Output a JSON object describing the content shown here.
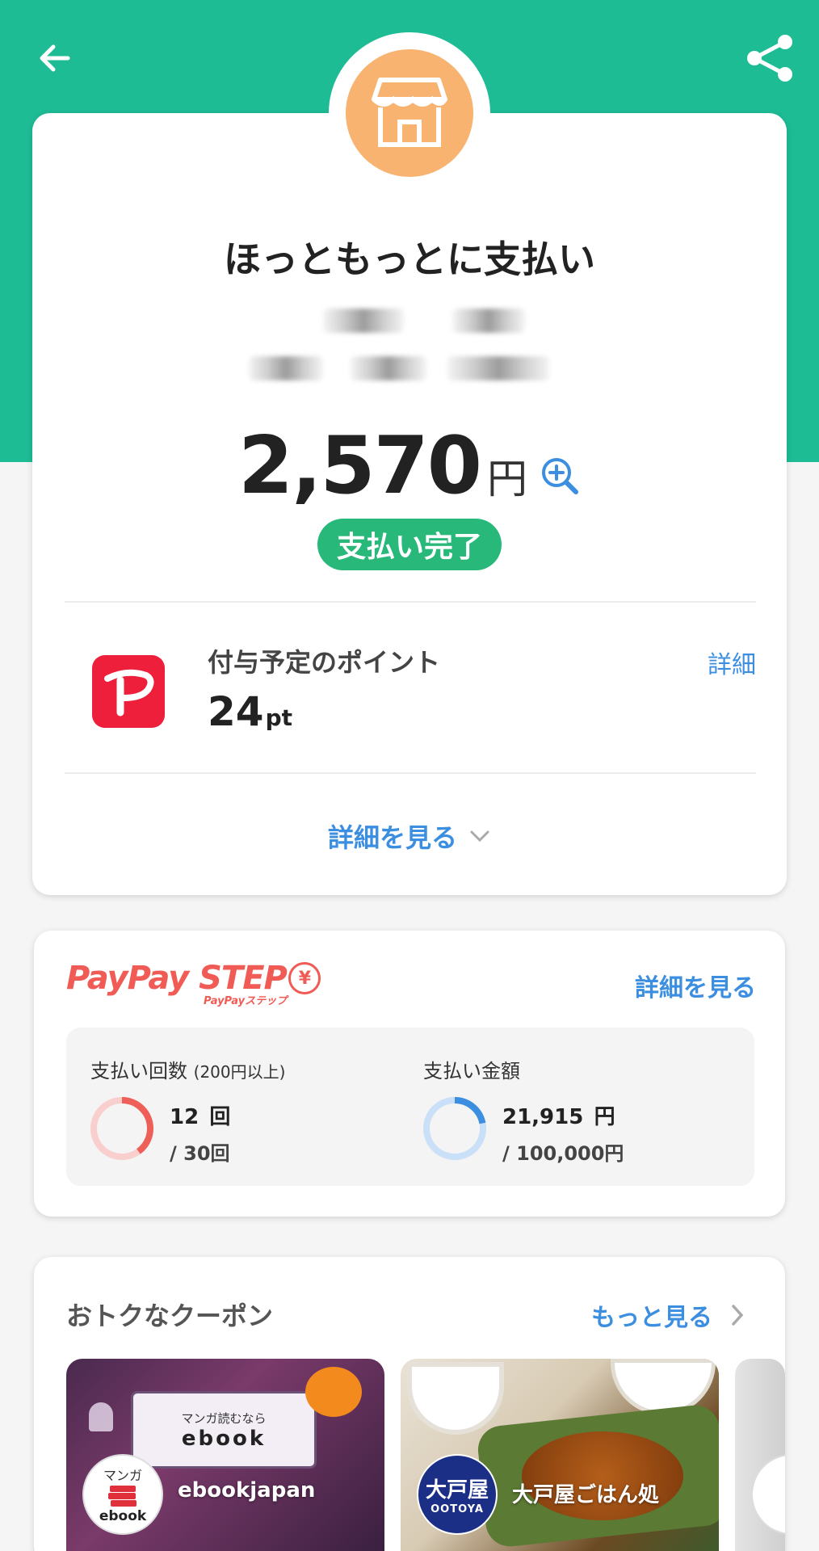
{
  "header": {
    "back_icon": "arrow-left-icon",
    "share_icon": "share-icon",
    "shop_icon": "shop-icon"
  },
  "colors": {
    "header_bg": "#1dbc95",
    "shop_circle": "#f7b36f",
    "status_green": "#27b87a",
    "link_blue": "#3b8ee0",
    "paypay_red": "#ee1f3a",
    "step_red": "#f05b55"
  },
  "payment": {
    "merchant": "ほっともっとに支払い",
    "amount": "2,570",
    "currency": "円",
    "status": "支払い完了"
  },
  "points": {
    "label": "付与予定のポイント",
    "value": "24",
    "unit": "pt",
    "detail_link": "詳細"
  },
  "see_details": "詳細を見る",
  "step": {
    "logo_main": "PayPay STEP",
    "logo_yen": "¥",
    "logo_sub": "PayPayステップ",
    "detail_link": "詳細を見る",
    "count": {
      "label": "支払い回数",
      "note": "(200円以上)",
      "value": "12",
      "unit": "回",
      "max": "/ 30回",
      "progress": 0.4
    },
    "sum": {
      "label": "支払い金額",
      "value": "21,915",
      "unit": "円",
      "max": "/ 100,000円",
      "progress": 0.22
    }
  },
  "coupons": {
    "title": "おトクなクーポン",
    "more": "もっと見る",
    "items": [
      {
        "name": "ebookjapan",
        "banner_top": "マンガ読むなら",
        "banner_brand": "ebook",
        "badge_top": "マンガ",
        "badge_bottom": "ebook"
      },
      {
        "name": "大戸屋ごはん処",
        "badge_top": "大戸屋",
        "badge_bottom": "OOTOYA"
      }
    ]
  }
}
